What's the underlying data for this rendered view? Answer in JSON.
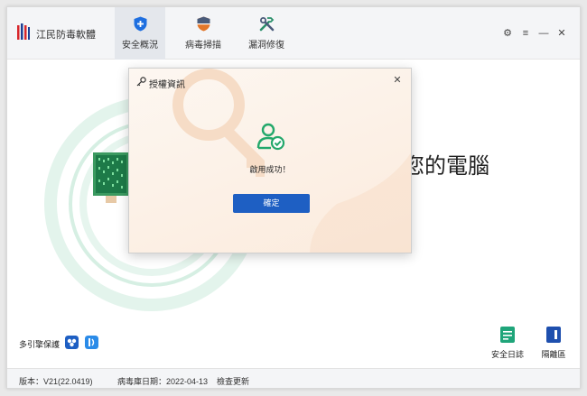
{
  "app": {
    "title": "江民防毒軟體"
  },
  "tabs": [
    {
      "label": "安全概況",
      "icon": "shield-plus-icon",
      "active": true
    },
    {
      "label": "病毒掃描",
      "icon": "scan-shield-icon",
      "active": false
    },
    {
      "label": "漏洞修復",
      "icon": "repair-tools-icon",
      "active": false
    }
  ],
  "window_controls": {
    "settings": "⚙",
    "menu": "≡",
    "minimize": "—",
    "close": "✕"
  },
  "hero": {
    "text": "您的電腦"
  },
  "engines": {
    "label": "多引擎保護"
  },
  "tools": [
    {
      "label": "安全日誌",
      "icon": "security-log-icon"
    },
    {
      "label": "隔離區",
      "icon": "quarantine-icon"
    }
  ],
  "footer": {
    "version": "版本：V21(22.0419)",
    "virus_db": "病毒庫日期：2022-04-13",
    "update": "檢查更新"
  },
  "modal": {
    "title": "授權資訊",
    "close": "✕",
    "message": "啟用成功！",
    "confirm": "確定"
  },
  "colors": {
    "accent": "#1e5fc3",
    "success": "#23a86b",
    "ring": "#d9f1e6"
  }
}
